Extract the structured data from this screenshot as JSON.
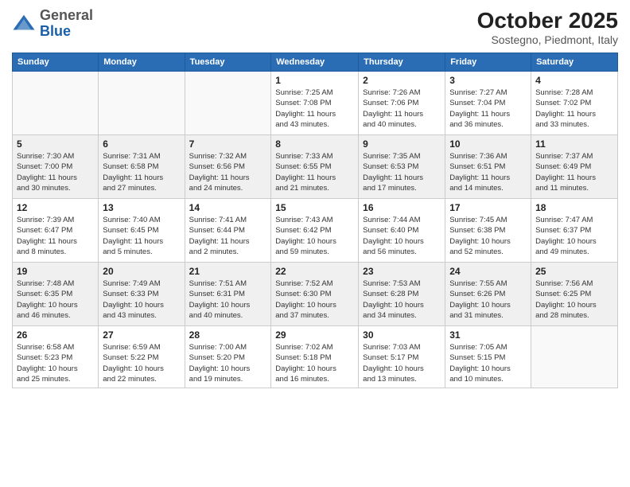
{
  "header": {
    "logo_general": "General",
    "logo_blue": "Blue",
    "month_title": "October 2025",
    "subtitle": "Sostegno, Piedmont, Italy"
  },
  "weekdays": [
    "Sunday",
    "Monday",
    "Tuesday",
    "Wednesday",
    "Thursday",
    "Friday",
    "Saturday"
  ],
  "weeks": [
    [
      {
        "day": "",
        "info": ""
      },
      {
        "day": "",
        "info": ""
      },
      {
        "day": "",
        "info": ""
      },
      {
        "day": "1",
        "info": "Sunrise: 7:25 AM\nSunset: 7:08 PM\nDaylight: 11 hours\nand 43 minutes."
      },
      {
        "day": "2",
        "info": "Sunrise: 7:26 AM\nSunset: 7:06 PM\nDaylight: 11 hours\nand 40 minutes."
      },
      {
        "day": "3",
        "info": "Sunrise: 7:27 AM\nSunset: 7:04 PM\nDaylight: 11 hours\nand 36 minutes."
      },
      {
        "day": "4",
        "info": "Sunrise: 7:28 AM\nSunset: 7:02 PM\nDaylight: 11 hours\nand 33 minutes."
      }
    ],
    [
      {
        "day": "5",
        "info": "Sunrise: 7:30 AM\nSunset: 7:00 PM\nDaylight: 11 hours\nand 30 minutes."
      },
      {
        "day": "6",
        "info": "Sunrise: 7:31 AM\nSunset: 6:58 PM\nDaylight: 11 hours\nand 27 minutes."
      },
      {
        "day": "7",
        "info": "Sunrise: 7:32 AM\nSunset: 6:56 PM\nDaylight: 11 hours\nand 24 minutes."
      },
      {
        "day": "8",
        "info": "Sunrise: 7:33 AM\nSunset: 6:55 PM\nDaylight: 11 hours\nand 21 minutes."
      },
      {
        "day": "9",
        "info": "Sunrise: 7:35 AM\nSunset: 6:53 PM\nDaylight: 11 hours\nand 17 minutes."
      },
      {
        "day": "10",
        "info": "Sunrise: 7:36 AM\nSunset: 6:51 PM\nDaylight: 11 hours\nand 14 minutes."
      },
      {
        "day": "11",
        "info": "Sunrise: 7:37 AM\nSunset: 6:49 PM\nDaylight: 11 hours\nand 11 minutes."
      }
    ],
    [
      {
        "day": "12",
        "info": "Sunrise: 7:39 AM\nSunset: 6:47 PM\nDaylight: 11 hours\nand 8 minutes."
      },
      {
        "day": "13",
        "info": "Sunrise: 7:40 AM\nSunset: 6:45 PM\nDaylight: 11 hours\nand 5 minutes."
      },
      {
        "day": "14",
        "info": "Sunrise: 7:41 AM\nSunset: 6:44 PM\nDaylight: 11 hours\nand 2 minutes."
      },
      {
        "day": "15",
        "info": "Sunrise: 7:43 AM\nSunset: 6:42 PM\nDaylight: 10 hours\nand 59 minutes."
      },
      {
        "day": "16",
        "info": "Sunrise: 7:44 AM\nSunset: 6:40 PM\nDaylight: 10 hours\nand 56 minutes."
      },
      {
        "day": "17",
        "info": "Sunrise: 7:45 AM\nSunset: 6:38 PM\nDaylight: 10 hours\nand 52 minutes."
      },
      {
        "day": "18",
        "info": "Sunrise: 7:47 AM\nSunset: 6:37 PM\nDaylight: 10 hours\nand 49 minutes."
      }
    ],
    [
      {
        "day": "19",
        "info": "Sunrise: 7:48 AM\nSunset: 6:35 PM\nDaylight: 10 hours\nand 46 minutes."
      },
      {
        "day": "20",
        "info": "Sunrise: 7:49 AM\nSunset: 6:33 PM\nDaylight: 10 hours\nand 43 minutes."
      },
      {
        "day": "21",
        "info": "Sunrise: 7:51 AM\nSunset: 6:31 PM\nDaylight: 10 hours\nand 40 minutes."
      },
      {
        "day": "22",
        "info": "Sunrise: 7:52 AM\nSunset: 6:30 PM\nDaylight: 10 hours\nand 37 minutes."
      },
      {
        "day": "23",
        "info": "Sunrise: 7:53 AM\nSunset: 6:28 PM\nDaylight: 10 hours\nand 34 minutes."
      },
      {
        "day": "24",
        "info": "Sunrise: 7:55 AM\nSunset: 6:26 PM\nDaylight: 10 hours\nand 31 minutes."
      },
      {
        "day": "25",
        "info": "Sunrise: 7:56 AM\nSunset: 6:25 PM\nDaylight: 10 hours\nand 28 minutes."
      }
    ],
    [
      {
        "day": "26",
        "info": "Sunrise: 6:58 AM\nSunset: 5:23 PM\nDaylight: 10 hours\nand 25 minutes."
      },
      {
        "day": "27",
        "info": "Sunrise: 6:59 AM\nSunset: 5:22 PM\nDaylight: 10 hours\nand 22 minutes."
      },
      {
        "day": "28",
        "info": "Sunrise: 7:00 AM\nSunset: 5:20 PM\nDaylight: 10 hours\nand 19 minutes."
      },
      {
        "day": "29",
        "info": "Sunrise: 7:02 AM\nSunset: 5:18 PM\nDaylight: 10 hours\nand 16 minutes."
      },
      {
        "day": "30",
        "info": "Sunrise: 7:03 AM\nSunset: 5:17 PM\nDaylight: 10 hours\nand 13 minutes."
      },
      {
        "day": "31",
        "info": "Sunrise: 7:05 AM\nSunset: 5:15 PM\nDaylight: 10 hours\nand 10 minutes."
      },
      {
        "day": "",
        "info": ""
      }
    ]
  ]
}
